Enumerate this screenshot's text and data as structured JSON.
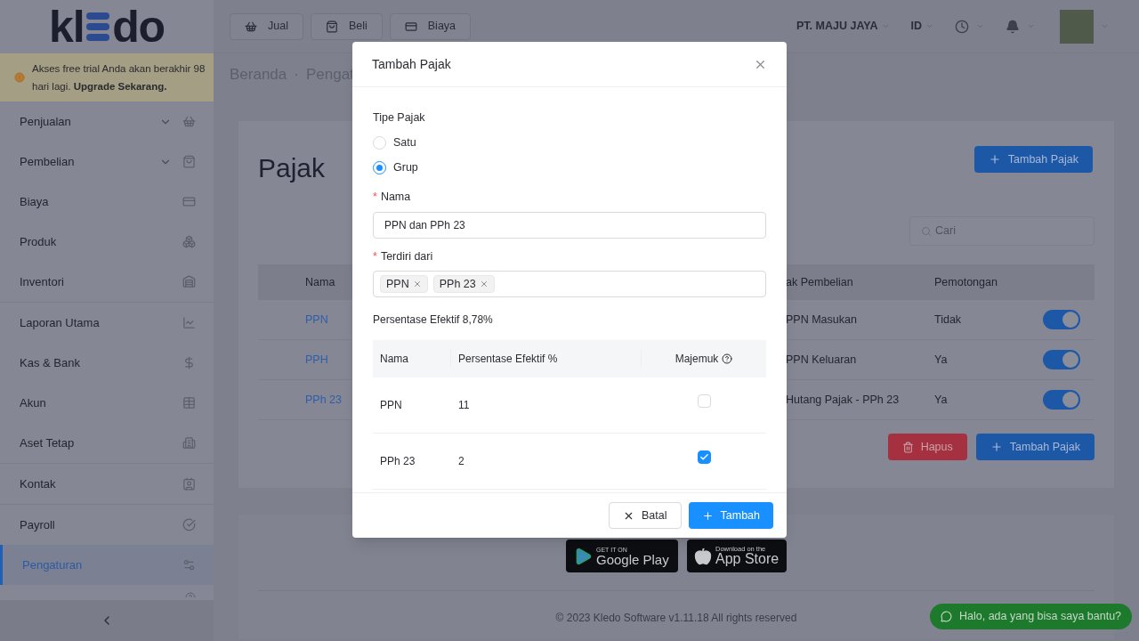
{
  "logo": {
    "left": "kl",
    "right": "do"
  },
  "trial_banner": "Akses free trial Anda akan berakhir 98 hari lagi. **Upgrade Sekarang.**",
  "sidebar": {
    "items": [
      {
        "label": "Penjualan",
        "has_submenu": true,
        "selected": false,
        "divider_after": false
      },
      {
        "label": "Pembelian",
        "has_submenu": true,
        "selected": false,
        "divider_after": false
      },
      {
        "label": "Biaya",
        "has_submenu": false,
        "selected": false,
        "divider_after": false
      },
      {
        "label": "Produk",
        "has_submenu": false,
        "selected": false,
        "divider_after": false
      },
      {
        "label": "Inventori",
        "has_submenu": false,
        "selected": false,
        "divider_after": true
      },
      {
        "label": "Laporan Utama",
        "has_submenu": false,
        "selected": false,
        "divider_after": false
      },
      {
        "label": "Kas & Bank",
        "has_submenu": false,
        "selected": false,
        "divider_after": false
      },
      {
        "label": "Akun",
        "has_submenu": false,
        "selected": false,
        "divider_after": false
      },
      {
        "label": "Aset Tetap",
        "has_submenu": false,
        "selected": false,
        "divider_after": true
      },
      {
        "label": "Kontak",
        "has_submenu": false,
        "selected": false,
        "divider_after": true
      },
      {
        "label": "Payroll",
        "has_submenu": false,
        "selected": false,
        "divider_after": false
      },
      {
        "label": "Pengaturan",
        "has_submenu": false,
        "selected": true,
        "divider_after": false
      }
    ]
  },
  "topbar": {
    "quick_buttons": [
      "Jual",
      "Beli",
      "Biaya"
    ],
    "company": "PT. MAJU JAYA",
    "language": "ID"
  },
  "breadcrumb": [
    "Beranda",
    "Pengat"
  ],
  "breadcrumb_separator": "·",
  "page": {
    "title": "Pajak",
    "add_button": "Tambah Pajak",
    "search": {
      "placeholder": "Cari"
    },
    "table": {
      "columns": [
        "Nama",
        "ak Pembelian",
        "Pemotongan"
      ],
      "rows": [
        {
          "name": "PPN",
          "purchase_account": "PPN Masukan",
          "deduction": "Tidak",
          "on": true
        },
        {
          "name": "PPH",
          "purchase_account": "PPN Keluaran",
          "deduction": "Ya",
          "on": true
        },
        {
          "name": "PPh 23",
          "purchase_account": "Hutang Pajak - PPh 23",
          "deduction": "Ya",
          "on": true
        }
      ]
    },
    "delete_button": "Hapus",
    "add_button_bottom": "Tambah Pajak"
  },
  "footer": {
    "google_play": {
      "small": "GET IT ON",
      "big": "Google Play"
    },
    "app_store": {
      "small": "Download on the",
      "big": "App Store"
    },
    "copyright": "© 2023 Kledo Software v1.11.18 All rights reserved"
  },
  "chat_button": "Halo, ada yang bisa saya bantu?",
  "modal": {
    "title": "Tambah Pajak",
    "type_label": "Tipe Pajak",
    "type_options": [
      {
        "label": "Satu",
        "selected": false
      },
      {
        "label": "Grup",
        "selected": true
      }
    ],
    "required_mark": "*",
    "name_label": "Nama",
    "name_value": "PPN dan PPh 23",
    "members_label": "Terdiri dari",
    "members": [
      "PPN",
      "PPh 23"
    ],
    "effective": "Persentase Efektif 8,78%",
    "table": {
      "columns": [
        "Nama",
        "Persentase Efektif %",
        "Majemuk"
      ],
      "rows": [
        {
          "name": "PPN",
          "percent": "11",
          "checked": false
        },
        {
          "name": "PPh 23",
          "percent": "2",
          "checked": true
        }
      ]
    },
    "cancel": "Batal",
    "submit": "Tambah"
  }
}
